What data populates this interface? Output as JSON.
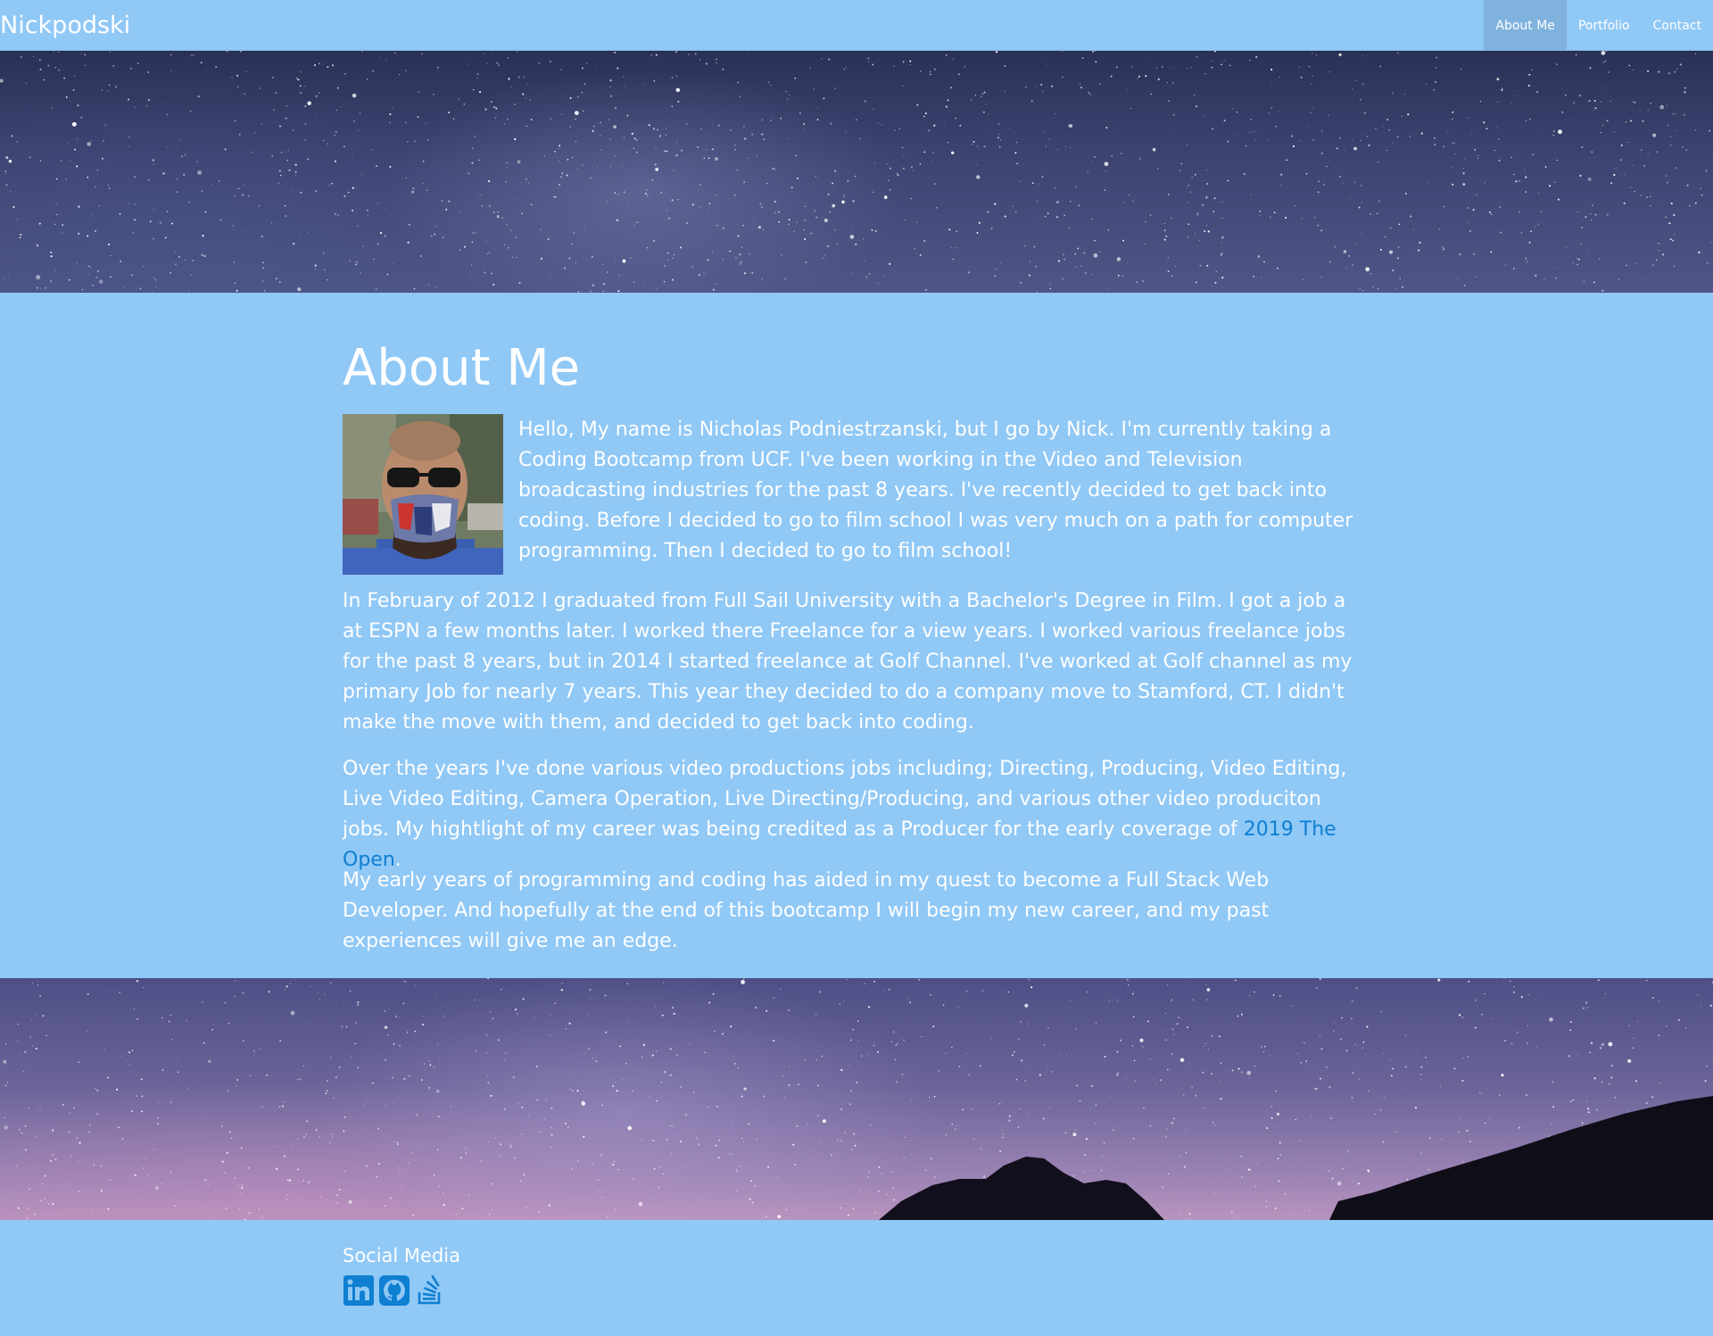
{
  "navbar": {
    "brand": "Nickpodski",
    "links": [
      {
        "label": "About Me",
        "active": true
      },
      {
        "label": "Portfolio",
        "active": false
      },
      {
        "label": "Contact",
        "active": false
      }
    ]
  },
  "about": {
    "title": "About Me",
    "paragraph1": "Hello, My name is Nicholas Podniestrzanski, but I go by Nick. I'm currently taking a Coding Bootcamp from UCF. I've been working in the Video and Television broadcasting industries for the past 8 years. I've recently decided to get back into coding. Before I decided to go to film school I was very much on a path for computer programming. Then I decided to go to film school!",
    "paragraph2": "In February of 2012 I graduated from Full Sail University with a Bachelor's Degree in Film. I got a job a at ESPN a few months later. I worked there Freelance for a view years. I worked various freelance jobs for the past 8 years, but in 2014 I started freelance at Golf Channel. I've worked at Golf channel as my primary Job for nearly 7 years. This year they decided to do a company move to Stamford, CT. I didn't make the move with them, and decided to get back into coding.",
    "paragraph3_before": "Over the years I've done various video productions jobs including; Directing, Producing, Video Editing, Live Video Editing, Camera Operation, Live Directing/Producing, and various other video produciton jobs. My hightlight of my career was being credited as a Producer for the early coverage of ",
    "paragraph3_link": "2019 The Open",
    "paragraph3_after": ".",
    "paragraph4": "My early years of programming and coding has aided in my quest to become a Full Stack Web Developer. And hopefully at the end of this bootcamp I will begin my new career, and my past experiences will give me an edge."
  },
  "footer": {
    "title": "Social Media",
    "icons": [
      "linkedin-icon",
      "github-icon",
      "stackoverflow-icon"
    ]
  },
  "colors": {
    "page_background": "#90c8f6",
    "nav_active": "#7fb3dd",
    "link": "#0f7fd1",
    "icon": "#0f7fd1",
    "text": "#ffffff"
  }
}
